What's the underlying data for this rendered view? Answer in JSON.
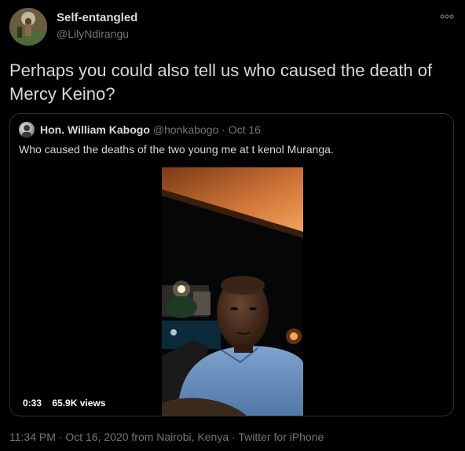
{
  "author": {
    "name": "Self-entangled",
    "handle": "@LilyNdirangu"
  },
  "tweet": {
    "text": "Perhaps you could also tell us who caused the death of Mercy Keino?"
  },
  "quoted": {
    "name": "Hon. William Kabogo",
    "handle": "@honkabogo",
    "date": "· Oct 16",
    "text": "Who caused the deaths of the two young me at t kenol Muranga.",
    "video": {
      "duration": "0:33",
      "views": "65.9K views"
    }
  },
  "footer": {
    "time": "11:34 PM",
    "date": "Oct 16, 2020 from Nairobi, Kenya",
    "client": "Twitter for iPhone",
    "separator": "·"
  },
  "icons": {
    "more": "more-options-icon"
  }
}
